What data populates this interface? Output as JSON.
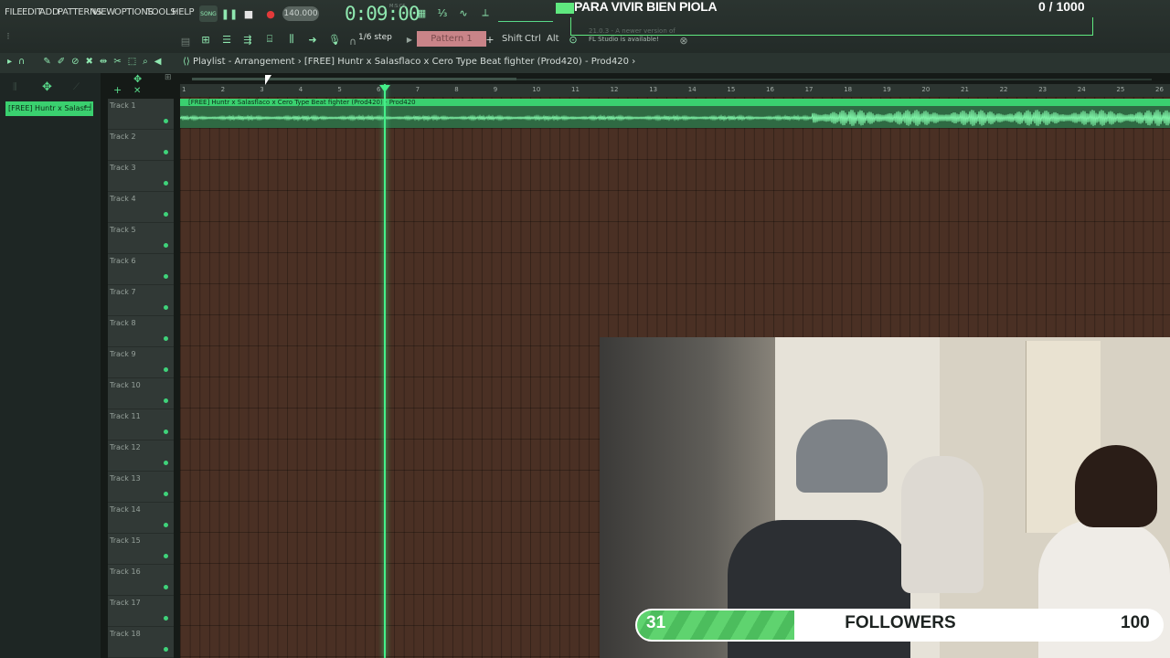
{
  "menu": [
    "FILE",
    "EDIT",
    "ADD",
    "PATTERNS",
    "VIEW",
    "OPTIONS",
    "TOOLS",
    "HELP"
  ],
  "transport": {
    "song_label": "SONG",
    "tempo": "140.000",
    "time": "0:09:00",
    "time_unit": "M:S:CS",
    "step": "1/6 step",
    "pattern": "Pattern 1"
  },
  "modifiers": [
    "Shift",
    "Ctrl",
    "Alt"
  ],
  "notification": {
    "line1": "21.0.3 - A newer version of",
    "line2": "FL Studio is available!"
  },
  "playlist": {
    "title": "Playlist - Arrangement",
    "separator": "›",
    "project": "[FREE] Huntr x Salasflaco x Cero  Type Beat  fighter  (Prod420) - Prod420"
  },
  "browser": {
    "item": "[FREE] Huntr x Salasf.."
  },
  "ruler": [
    "1",
    "2",
    "3",
    "4",
    "5",
    "6",
    "7",
    "8",
    "9",
    "10",
    "11",
    "12",
    "13",
    "14",
    "15",
    "16",
    "17",
    "18",
    "19",
    "20",
    "21",
    "22",
    "23",
    "24",
    "25",
    "26"
  ],
  "tracks": [
    "Track 1",
    "Track 2",
    "Track 3",
    "Track 4",
    "Track 5",
    "Track 6",
    "Track 7",
    "Track 8",
    "Track 9",
    "Track 10",
    "Track 11",
    "Track 12",
    "Track 13",
    "Track 14",
    "Track 15",
    "Track 16",
    "Track 17",
    "Track 18"
  ],
  "clip": {
    "label": "[FREE] Huntr x Salasflaco x Cero  Type Beat  fighter  (Prod420) - Prod420"
  },
  "overlay": {
    "goal_title": "PARA VIVIR BIEN PIOLA",
    "goal_count": "0  / 1000"
  },
  "followers": {
    "current": "31",
    "label": "FOLLOWERS",
    "goal": "100",
    "progress": 0.31
  },
  "colors": {
    "accent": "#3ad06f",
    "grid": "#4a3024",
    "playhead": "#44f089"
  }
}
